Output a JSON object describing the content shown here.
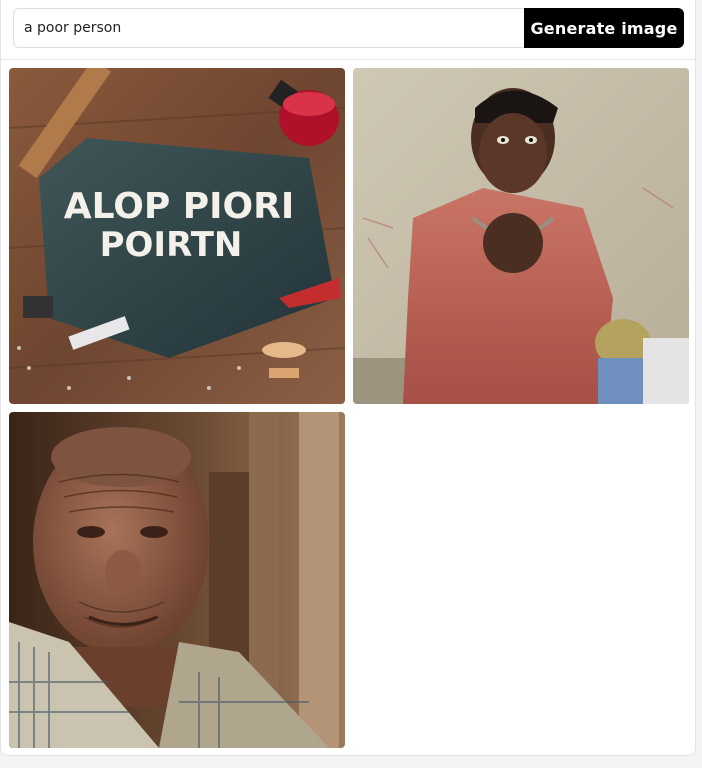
{
  "prompt": {
    "value": "a poor person"
  },
  "generate_button": {
    "label": "Generate image"
  },
  "results": [
    {
      "overlay_text_line1": "ALOP PIORI",
      "overlay_text_line2": "POIRTN"
    },
    {},
    {}
  ]
}
